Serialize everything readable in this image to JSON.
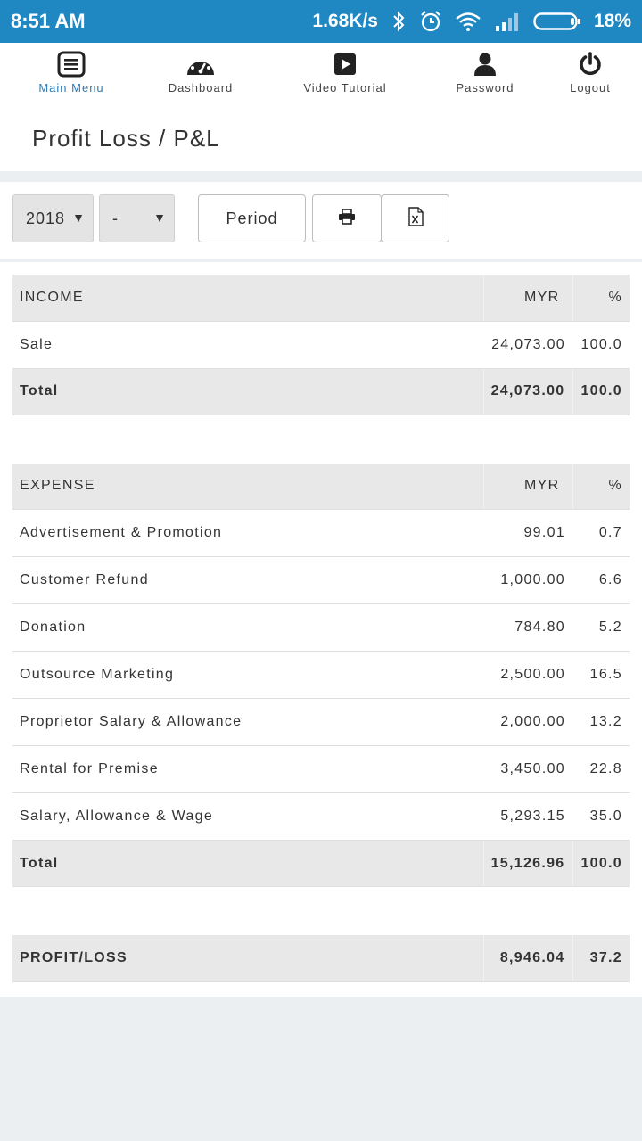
{
  "statusbar": {
    "time": "8:51 AM",
    "speed": "1.68K/s",
    "battery": "18%",
    "icons": [
      "bluetooth-icon",
      "alarm-icon",
      "wifi-icon",
      "signal-icon",
      "battery-icon"
    ]
  },
  "nav": {
    "items": [
      {
        "label": "Main Menu",
        "icon": "menu-icon",
        "active": true
      },
      {
        "label": "Dashboard",
        "icon": "dashboard-gauge-icon"
      },
      {
        "label": "Video Tutorial",
        "icon": "video-play-icon"
      },
      {
        "label": "Password",
        "icon": "user-icon"
      },
      {
        "label": "Logout",
        "icon": "power-icon"
      }
    ]
  },
  "page": {
    "title": "Profit Loss / P&L"
  },
  "toolbar": {
    "year_value": "2018",
    "period_value": "-",
    "period_button": "Period",
    "print_icon": "print-icon",
    "excel_icon": "excel-export-icon"
  },
  "income": {
    "header": {
      "label": "INCOME",
      "currency": "MYR",
      "pct": "%"
    },
    "rows": [
      {
        "label": "Sale",
        "amount": "24,073.00",
        "pct": "100.0"
      }
    ],
    "total": {
      "label": "Total",
      "amount": "24,073.00",
      "pct": "100.0"
    }
  },
  "expense": {
    "header": {
      "label": "EXPENSE",
      "currency": "MYR",
      "pct": "%"
    },
    "rows": [
      {
        "label": "Advertisement & Promotion",
        "amount": "99.01",
        "pct": "0.7"
      },
      {
        "label": "Customer Refund",
        "amount": "1,000.00",
        "pct": "6.6"
      },
      {
        "label": "Donation",
        "amount": "784.80",
        "pct": "5.2"
      },
      {
        "label": "Outsource Marketing",
        "amount": "2,500.00",
        "pct": "16.5"
      },
      {
        "label": "Proprietor Salary & Allowance",
        "amount": "2,000.00",
        "pct": "13.2"
      },
      {
        "label": "Rental for Premise",
        "amount": "3,450.00",
        "pct": "22.8"
      },
      {
        "label": "Salary, Allowance & Wage",
        "amount": "5,293.15",
        "pct": "35.0"
      }
    ],
    "total": {
      "label": "Total",
      "amount": "15,126.96",
      "pct": "100.0"
    }
  },
  "profit": {
    "label": "PROFIT/LOSS",
    "amount": "8,946.04",
    "pct": "37.2"
  },
  "colors": {
    "statusbar": "#1f87c2",
    "active_nav": "#2e7bb4",
    "row_header": "#e8e8e8",
    "background": "#eceff1"
  }
}
